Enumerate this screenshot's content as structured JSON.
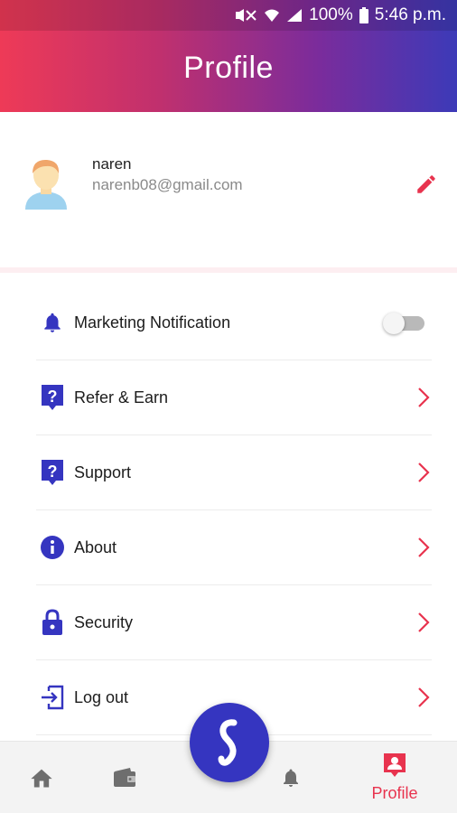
{
  "status_bar": {
    "battery": "100%",
    "time": "5:46 p.m."
  },
  "header": {
    "title": "Profile"
  },
  "profile": {
    "name": "naren",
    "email": "narenb08@gmail.com"
  },
  "menu": {
    "items": [
      {
        "label": "Marketing Notification",
        "icon": "bell-icon",
        "control": "toggle",
        "toggle_on": false
      },
      {
        "label": "Refer & Earn",
        "icon": "question-badge-icon",
        "control": "chevron"
      },
      {
        "label": "Support",
        "icon": "question-badge-icon",
        "control": "chevron"
      },
      {
        "label": "About",
        "icon": "info-icon",
        "control": "chevron"
      },
      {
        "label": "Security",
        "icon": "lock-icon",
        "control": "chevron"
      },
      {
        "label": "Log out",
        "icon": "logout-icon",
        "control": "chevron"
      }
    ]
  },
  "bottom_nav": {
    "items": [
      {
        "icon": "home-icon"
      },
      {
        "icon": "wallet-icon"
      },
      {
        "icon": "app-logo-icon"
      },
      {
        "icon": "bell-icon"
      },
      {
        "icon": "profile-icon",
        "label": "Profile",
        "active": true
      }
    ]
  },
  "colors": {
    "accent": "#e8334e",
    "primary": "#3535c0",
    "gradient_start": "#ee3a57",
    "gradient_end": "#3c3ab8"
  }
}
